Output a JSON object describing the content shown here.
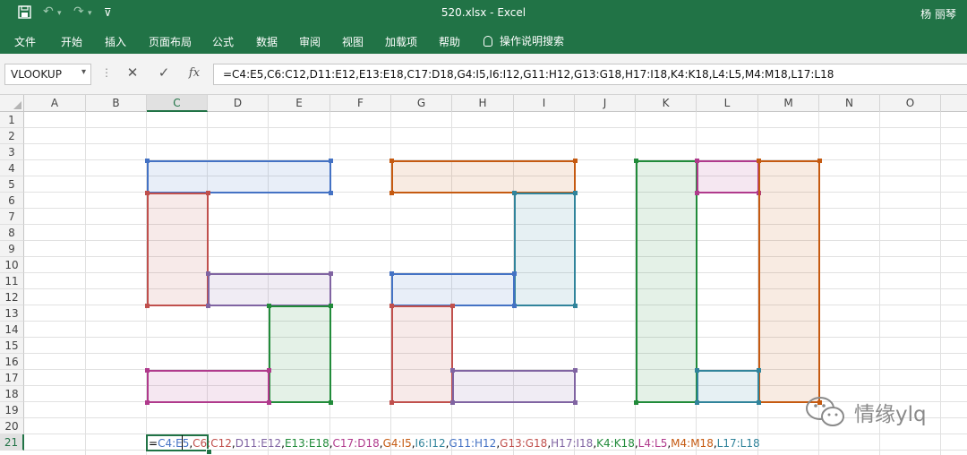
{
  "window": {
    "title": "520.xlsx  -  Excel",
    "user": "杨 丽琴",
    "quick_access": {
      "save_icon": "save-icon",
      "undo_icon": "↶",
      "redo_icon": "↷",
      "customize_icon": "⊽"
    }
  },
  "ribbon": {
    "tabs": [
      "文件",
      "开始",
      "插入",
      "页面布局",
      "公式",
      "数据",
      "审阅",
      "视图",
      "加载项",
      "帮助"
    ],
    "tell_me": "操作说明搜索"
  },
  "formula_bar": {
    "name_box": "VLOOKUP",
    "cancel_icon": "✕",
    "enter_icon": "✓",
    "fx_icon": "fx",
    "formula": "=C4:E5,C6:C12,D11:E12,E13:E18,C17:D18,G4:I5,I6:I12,G11:H12,G13:G18,H17:I18,K4:K18,L4:L5,M4:M18,L17:L18"
  },
  "columns": [
    "A",
    "B",
    "C",
    "D",
    "E",
    "F",
    "G",
    "H",
    "I",
    "J",
    "K",
    "L",
    "M",
    "N",
    "O"
  ],
  "rows": [
    "1",
    "2",
    "3",
    "4",
    "5",
    "6",
    "7",
    "8",
    "9",
    "10",
    "11",
    "12",
    "13",
    "14",
    "15",
    "16",
    "17",
    "18",
    "19",
    "20",
    "21"
  ],
  "active_cell": "C21",
  "cell_edit": {
    "prefix": "=",
    "refs": [
      {
        "ref": "C4:E5",
        "color": "#4472c4"
      },
      {
        "ref": "C6:C12",
        "color": "#c0504d"
      },
      {
        "ref": "D11:E12",
        "color": "#8064a2"
      },
      {
        "ref": "E13:E18",
        "color": "#218b3a"
      },
      {
        "ref": "C17:D18",
        "color": "#b03a8c"
      },
      {
        "ref": "G4:I5",
        "color": "#c55a11"
      },
      {
        "ref": "I6:I12",
        "color": "#31849b"
      },
      {
        "ref": "G11:H12",
        "color": "#4472c4"
      },
      {
        "ref": "G13:G18",
        "color": "#c0504d"
      },
      {
        "ref": "H17:I18",
        "color": "#8064a2"
      },
      {
        "ref": "K4:K18",
        "color": "#218b3a"
      },
      {
        "ref": "L4:L5",
        "color": "#b03a8c"
      },
      {
        "ref": "M4:M18",
        "color": "#c55a11"
      },
      {
        "ref": "L17:L18",
        "color": "#31849b"
      }
    ]
  },
  "watermark": "情缘ylq"
}
